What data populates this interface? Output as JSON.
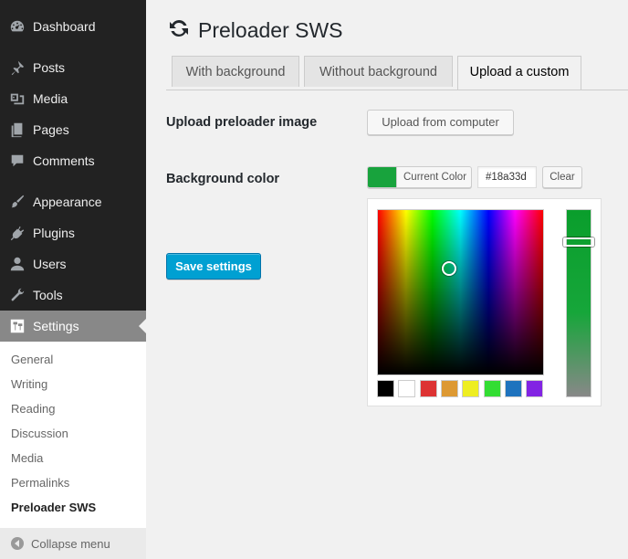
{
  "sidebar": {
    "items": [
      {
        "label": "Dashboard",
        "icon": "dashboard-icon"
      },
      {
        "label": "Posts",
        "icon": "pin-icon"
      },
      {
        "label": "Media",
        "icon": "media-icon"
      },
      {
        "label": "Pages",
        "icon": "pages-icon"
      },
      {
        "label": "Comments",
        "icon": "comment-icon"
      },
      {
        "label": "Appearance",
        "icon": "brush-icon"
      },
      {
        "label": "Plugins",
        "icon": "plug-icon"
      },
      {
        "label": "Users",
        "icon": "user-icon"
      },
      {
        "label": "Tools",
        "icon": "wrench-icon"
      },
      {
        "label": "Settings",
        "icon": "settings-icon",
        "active": true
      }
    ],
    "submenu": [
      "General",
      "Writing",
      "Reading",
      "Discussion",
      "Media",
      "Permalinks",
      "Preloader SWS"
    ],
    "current_submenu": "Preloader SWS",
    "collapse_label": "Collapse menu"
  },
  "page": {
    "title": "Preloader SWS",
    "title_icon": "refresh-icon"
  },
  "tabs": [
    {
      "label": "With background",
      "active": false
    },
    {
      "label": "Without background",
      "active": false
    },
    {
      "label": "Upload a custom",
      "active": true
    }
  ],
  "form": {
    "upload_label": "Upload preloader image",
    "upload_button": "Upload from computer",
    "bg_color_label": "Background color",
    "current_color_label": "Current Color",
    "color_value": "#18a33d",
    "clear_button": "Clear",
    "save_button": "Save settings"
  },
  "colors": {
    "accent": "#00a0d2",
    "current_color": "#18a33d",
    "sidebar_bg": "#222222",
    "active_menu_bg": "#888888"
  },
  "palette": [
    "#000000",
    "#ffffff",
    "#dd3333",
    "#dd9933",
    "#eeee22",
    "#33dd33",
    "#1e73be",
    "#8224e3"
  ]
}
